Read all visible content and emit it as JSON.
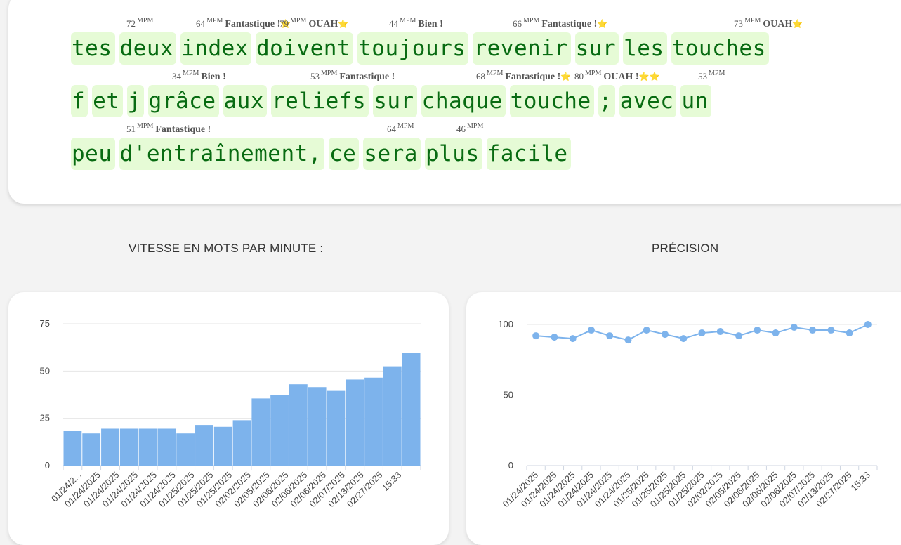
{
  "typing": {
    "lines": [
      {
        "words": [
          "tes",
          "deux",
          "index",
          "doivent",
          "toujours",
          "revenir",
          "sur",
          "les",
          "touches"
        ],
        "annotations": [
          {
            "num": "72",
            "unit": "MPM",
            "label": "",
            "stars": ""
          },
          {
            "num": "64",
            "unit": "MPM",
            "label": "Fantastique !",
            "stars": "⭐"
          },
          {
            "num": "79",
            "unit": "MPM",
            "label": "OUAH",
            "stars": "⭐"
          },
          {
            "num": "44",
            "unit": "MPM",
            "label": "Bien !",
            "stars": ""
          },
          {
            "num": "66",
            "unit": "MPM",
            "label": "Fantastique !",
            "stars": "⭐"
          },
          {
            "num": "73",
            "unit": "MPM",
            "label": "OUAH",
            "stars": "⭐"
          }
        ]
      },
      {
        "words": [
          "f",
          "et",
          "j",
          "grâce",
          "aux",
          "reliefs",
          "sur",
          "chaque",
          "touche",
          ";",
          "avec",
          "un"
        ],
        "annotations": [
          {
            "num": "34",
            "unit": "MPM",
            "label": "Bien !",
            "stars": ""
          },
          {
            "num": "53",
            "unit": "MPM",
            "label": "Fantastique !",
            "stars": ""
          },
          {
            "num": "68",
            "unit": "MPM",
            "label": "Fantastique !",
            "stars": "⭐"
          },
          {
            "num": "80",
            "unit": "MPM",
            "label": "OUAH !",
            "stars": "⭐⭐"
          },
          {
            "num": "53",
            "unit": "MPM",
            "label": "",
            "stars": ""
          }
        ]
      },
      {
        "words": [
          "peu",
          "d'entraînement,",
          "ce",
          "sera",
          "plus",
          "facile"
        ],
        "annotations": [
          {
            "num": "51",
            "unit": "MPM",
            "label": "Fantastique !",
            "stars": ""
          },
          {
            "num": "64",
            "unit": "MPM",
            "label": "",
            "stars": ""
          },
          {
            "num": "46",
            "unit": "MPM",
            "label": "",
            "stars": ""
          }
        ]
      }
    ]
  },
  "sections": {
    "speed_title": "VITESSE EN MOTS PAR MINUTE :",
    "accuracy_title": "PRÉCISION"
  },
  "chart_data": [
    {
      "type": "bar",
      "title": "VITESSE EN MOTS PAR MINUTE :",
      "color": "#7db3ec",
      "categories": [
        "01/24/2...",
        "01/24/2025",
        "01/24/2025",
        "01/24/2025",
        "01/24/2025",
        "01/24/2025",
        "01/25/2025",
        "01/25/2025",
        "01/25/2025",
        "02/02/2025",
        "02/05/2025",
        "02/06/2025",
        "02/06/2025",
        "02/06/2025",
        "02/07/2025",
        "02/13/2025",
        "02/27/2025",
        "15:33"
      ],
      "values": [
        18.5,
        17,
        19.5,
        19.5,
        19.5,
        19.5,
        17,
        21.5,
        20.5,
        24,
        35.5,
        37.5,
        43,
        41.5,
        39.5,
        45.5,
        46.5,
        52.5,
        59.5
      ],
      "ylim": [
        0,
        75
      ],
      "yticks": [
        0,
        25,
        50,
        75
      ],
      "grid": true
    },
    {
      "type": "line",
      "title": "PRÉCISION",
      "color": "#7db3ec",
      "categories": [
        "01/24/2025",
        "01/24/2025",
        "01/24/2025",
        "01/24/2025",
        "01/24/2025",
        "01/24/2025",
        "01/25/2025",
        "01/25/2025",
        "01/25/2025",
        "01/25/2025",
        "02/02/2025",
        "02/05/2025",
        "02/06/2025",
        "02/06/2025",
        "02/06/2025",
        "02/07/2025",
        "02/13/2025",
        "02/27/2025",
        "15:33"
      ],
      "values": [
        92,
        91,
        90,
        96,
        92,
        89,
        96,
        93,
        90,
        94,
        95,
        92,
        96,
        94,
        98,
        96,
        96,
        94,
        100
      ],
      "ylim": [
        0,
        100
      ],
      "yticks": [
        0,
        50,
        100
      ],
      "grid": true
    }
  ]
}
